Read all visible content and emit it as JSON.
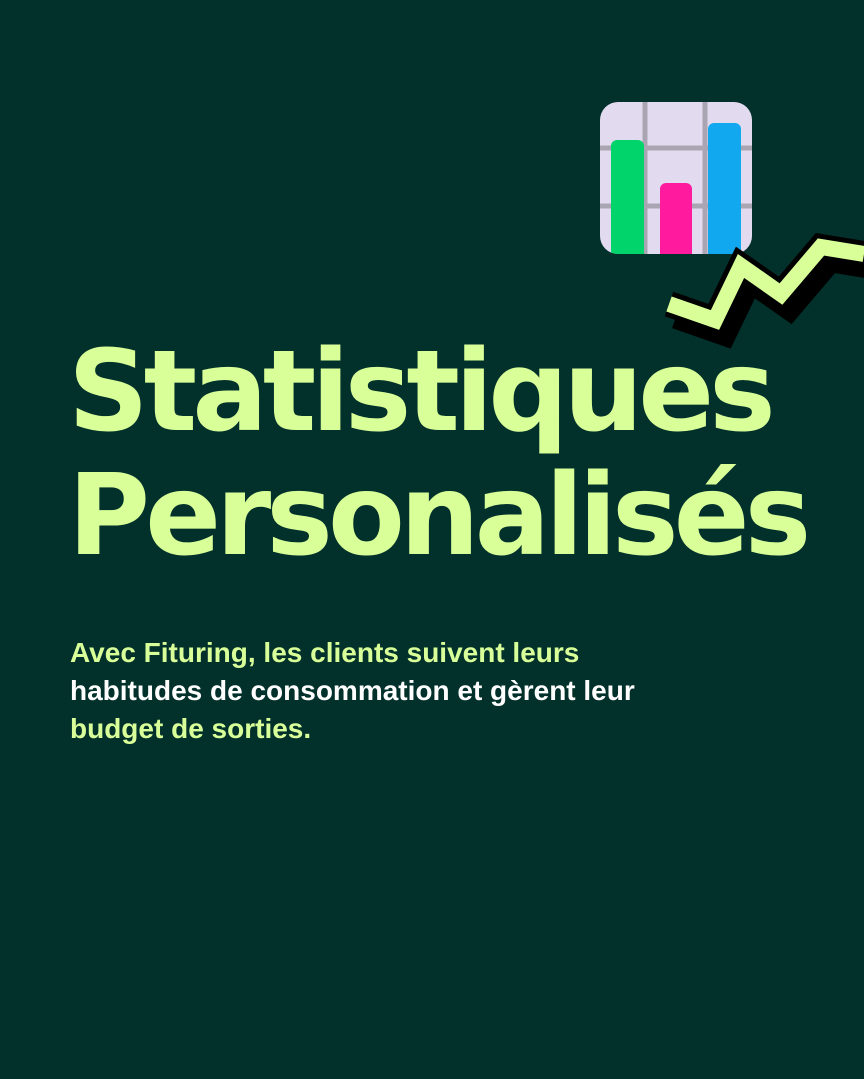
{
  "title": {
    "line1": "Statistiques",
    "line2": "Personalisés"
  },
  "description": {
    "line1": "Avec Fituring, les clients suivent leurs",
    "line2": "habitudes de consommation et gèrent leur",
    "line3": "budget de sorties."
  },
  "icons": {
    "chart": "bar-chart-icon",
    "decoration": "zigzag-arrow-icon"
  },
  "colors": {
    "background": "#02302b",
    "accent": "#d9ff99",
    "text_highlight": "#ffffff",
    "bar_green": "#00d46a",
    "bar_pink": "#ff1a9e",
    "bar_blue": "#12a8f0"
  }
}
